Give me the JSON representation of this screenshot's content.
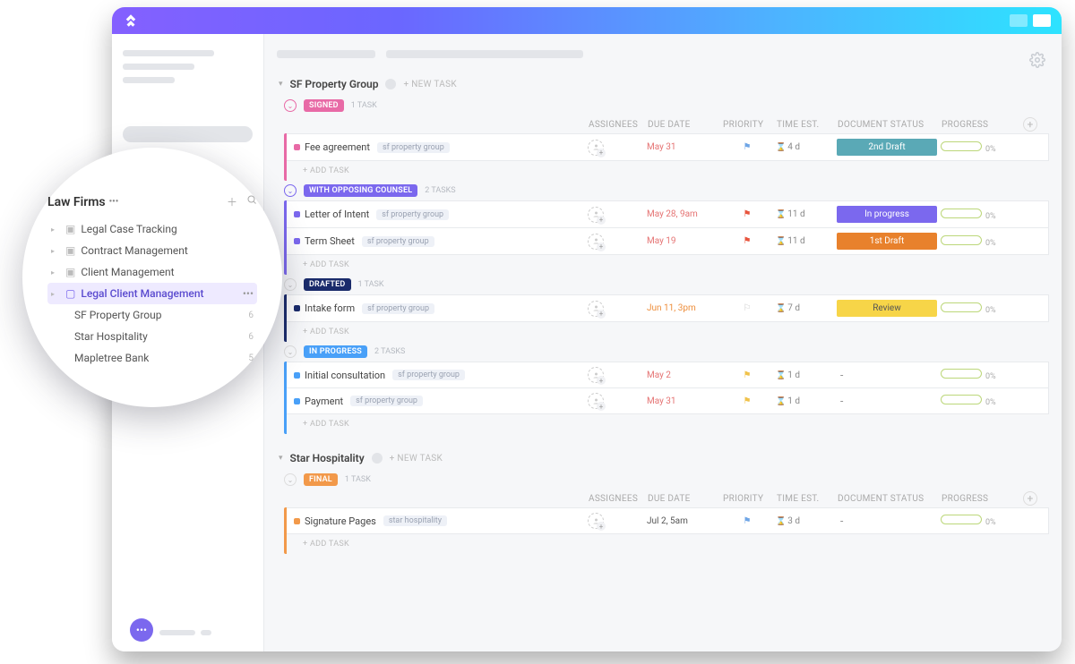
{
  "columns": {
    "assignees": "ASSIGNEES",
    "due": "DUE DATE",
    "priority": "PRIORITY",
    "time": "TIME EST.",
    "docstatus": "DOCUMENT STATUS",
    "progress": "PROGRESS"
  },
  "labels": {
    "new_task": "+ NEW TASK",
    "add_task": "+ ADD TASK"
  },
  "popup": {
    "title": "Law Firms",
    "items": [
      {
        "name": "Legal Case Tracking",
        "icon": "folder"
      },
      {
        "name": "Contract Management",
        "icon": "folder"
      },
      {
        "name": "Client Management",
        "icon": "folder"
      },
      {
        "name": "Legal Client Management",
        "icon": "folder-open",
        "active": true
      }
    ],
    "sub": [
      {
        "name": "SF Property Group",
        "count": "6"
      },
      {
        "name": "Star Hospitality",
        "count": "6"
      },
      {
        "name": "Mapletree Bank",
        "count": "5"
      }
    ]
  },
  "groups": [
    {
      "name": "SF Property Group",
      "statuses": [
        {
          "label": "SIGNED",
          "color": "#e86aa6",
          "count": "1 TASK",
          "tasks": [
            {
              "name": "Fee agreement",
              "tag": "sf property group",
              "due": "May 31",
              "flag": "blue",
              "time": "4 d",
              "doc": "2nd Draft",
              "docclass": "d2",
              "progress": "0%",
              "dot": "#e86aa6"
            }
          ]
        },
        {
          "label": "WITH OPPOSING COUNSEL",
          "color": "#7b68ee",
          "count": "2 TASKS",
          "tasks": [
            {
              "name": "Letter of Intent",
              "tag": "sf property group",
              "due": "May 28, 9am",
              "flag": "red",
              "time": "11 d",
              "doc": "In progress",
              "docclass": "prog",
              "progress": "0%",
              "dot": "#7b68ee"
            },
            {
              "name": "Term Sheet",
              "tag": "sf property group",
              "due": "May 19",
              "flag": "red",
              "time": "11 d",
              "doc": "1st Draft",
              "docclass": "d1",
              "progress": "0%",
              "dot": "#7b68ee"
            }
          ]
        },
        {
          "label": "DRAFTED",
          "color": "#1a2b6b",
          "count": "1 TASK",
          "tasks": [
            {
              "name": "Intake form",
              "tag": "sf property group",
              "due": "Jun 11, 3pm",
              "dueclass": "orange",
              "flag": "",
              "time": "7 d",
              "doc": "Review",
              "docclass": "review",
              "progress": "0%",
              "dot": "#1a2b6b"
            }
          ]
        },
        {
          "label": "IN PROGRESS",
          "color": "#49a0f8",
          "count": "2 TASKS",
          "tasks": [
            {
              "name": "Initial consultation",
              "tag": "sf property group",
              "due": "May 2",
              "flag": "yellow",
              "time": "1 d",
              "doc": "-",
              "docclass": "",
              "progress": "0%",
              "dot": "#49a0f8"
            },
            {
              "name": "Payment",
              "tag": "sf property group",
              "due": "May 31",
              "flag": "yellow",
              "time": "1 d",
              "doc": "-",
              "docclass": "",
              "progress": "0%",
              "dot": "#49a0f8"
            }
          ]
        }
      ]
    },
    {
      "name": "Star Hospitality",
      "statuses": [
        {
          "label": "FINAL",
          "color": "#f2994a",
          "count": "1 TASK",
          "tasks": [
            {
              "name": "Signature Pages",
              "tag": "star hospitality",
              "due": "Jul 2, 5am",
              "dueclass": "dark",
              "flag": "blue",
              "time": "3 d",
              "doc": "-",
              "docclass": "",
              "progress": "0%",
              "dot": "#f2994a"
            }
          ]
        }
      ]
    }
  ]
}
